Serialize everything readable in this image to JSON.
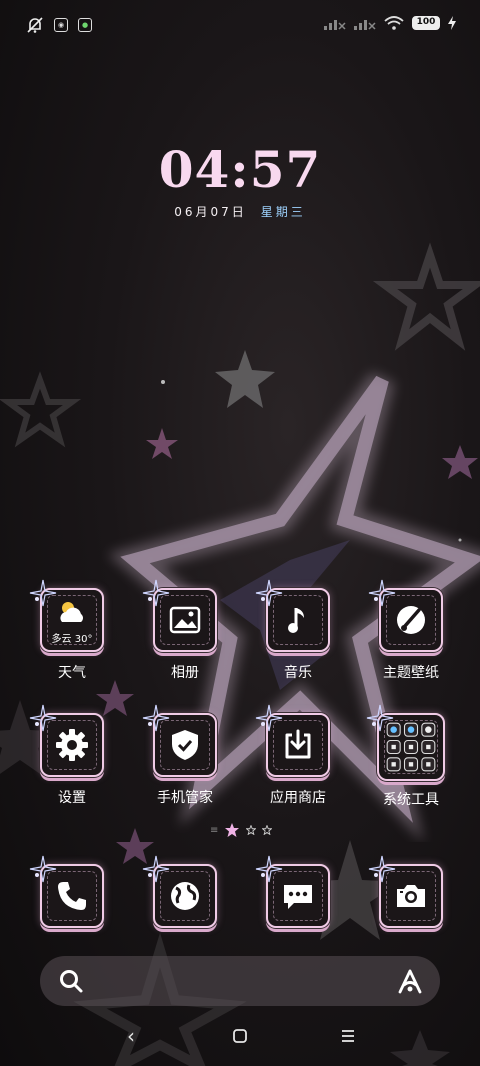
{
  "status_bar": {
    "battery": "100",
    "left_icons": [
      "mute-bell-icon",
      "chat-app-icon",
      "camera-app-icon"
    ],
    "right_icons": [
      "signal-1-icon",
      "signal-2-icon",
      "wifi-icon",
      "battery-icon",
      "charging-icon"
    ]
  },
  "clock": {
    "time": "04:57",
    "date": "06月07日",
    "weekday": "星期三"
  },
  "apps": {
    "row1": [
      {
        "label": "天气",
        "icon": "weather-icon",
        "temp": "多云 30°"
      },
      {
        "label": "相册",
        "icon": "gallery-icon"
      },
      {
        "label": "音乐",
        "icon": "music-icon"
      },
      {
        "label": "主题壁纸",
        "icon": "theme-icon"
      }
    ],
    "row2": [
      {
        "label": "设置",
        "icon": "settings-icon"
      },
      {
        "label": "手机管家",
        "icon": "security-icon"
      },
      {
        "label": "应用商店",
        "icon": "app-store-icon"
      },
      {
        "label": "系统工具",
        "icon": "tools-folder-icon"
      }
    ]
  },
  "dock": [
    {
      "icon": "phone-icon"
    },
    {
      "icon": "browser-icon"
    },
    {
      "icon": "messages-icon"
    },
    {
      "icon": "camera-icon"
    }
  ],
  "page_indicator": {
    "pages": 3,
    "current": 1
  },
  "colors": {
    "accent_pink": "#f0cbe6",
    "weekday_blue": "#9fd3ff",
    "tile_bg": "#1b1618"
  }
}
